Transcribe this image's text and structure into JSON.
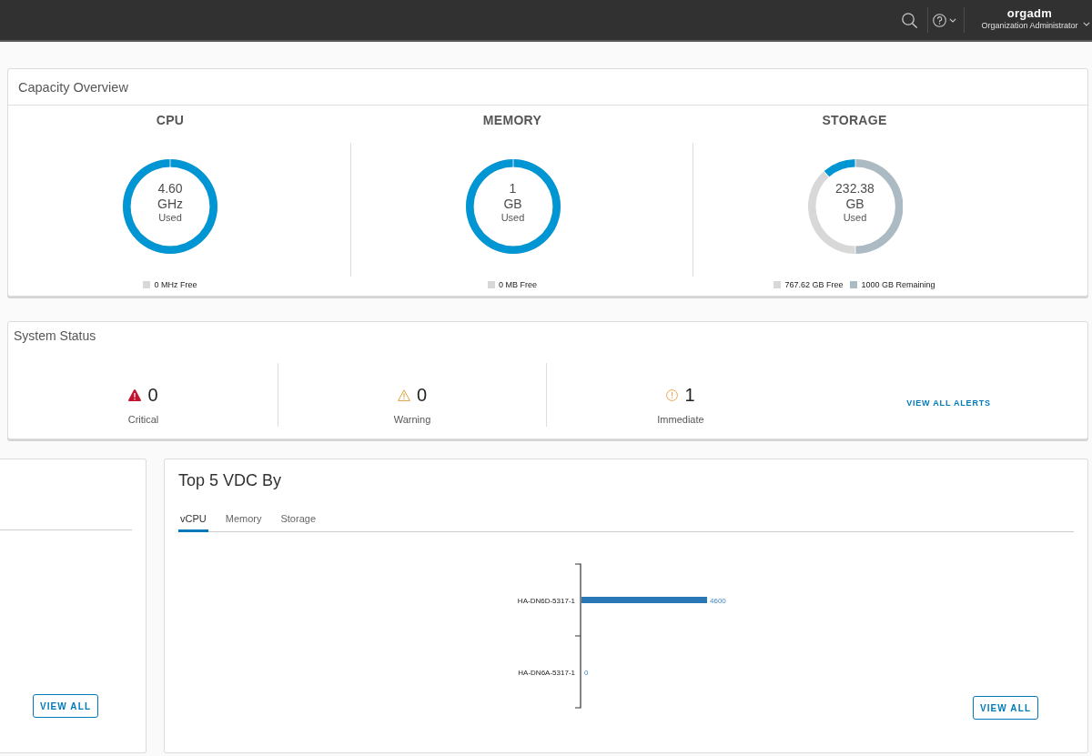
{
  "header": {
    "user_name": "orgadm",
    "user_role": "Organization Administrator"
  },
  "capacity_overview": {
    "title": "Capacity Overview",
    "panels": [
      {
        "title": "CPU",
        "used_value": "4.60",
        "used_unit": "GHz",
        "used_label": "Used",
        "level": 1,
        "legend": [
          {
            "label": "0 MHz Free",
            "color": "#d8d8d8"
          }
        ]
      },
      {
        "title": "MEMORY",
        "used_value": "1",
        "used_unit": "GB",
        "used_label": "Used",
        "level": 1,
        "legend": [
          {
            "label": "0 MB Free",
            "color": "#d8d8d8"
          }
        ]
      },
      {
        "title": "STORAGE",
        "used_value": "232.38",
        "used_unit": "GB",
        "used_label": "Used",
        "legend": [
          {
            "label": "767.62 GB Free",
            "color": "#d8d8d8"
          },
          {
            "label": "1000 GB Remaining",
            "color": "#acbac3"
          }
        ],
        "chart_data": {
          "type": "donut",
          "values": [
            11.62,
            38.38,
            50
          ]
        }
      }
    ]
  },
  "system_status": {
    "title": "System Status",
    "counters": [
      {
        "kind": "critical",
        "count": "0",
        "label": "Critical"
      },
      {
        "kind": "warning",
        "count": "0",
        "label": "Warning"
      },
      {
        "kind": "immediate",
        "count": "1",
        "label": "Immediate"
      }
    ],
    "view_all_link": "VIEW ALL ALERTS"
  },
  "left_panel": {
    "button": "VIEW ALL"
  },
  "top_vdc": {
    "title": "Top 5 VDC By",
    "tabs": [
      {
        "label": "vCPU",
        "selected": true
      },
      {
        "label": "Memory",
        "selected": false
      },
      {
        "label": "Storage",
        "selected": false
      }
    ],
    "chart_data": {
      "type": "bar",
      "orientation": "horizontal",
      "categories": [
        "HA-DN6D-5317-1",
        "HA-DN6A-5317-1"
      ],
      "values": [
        4600,
        0
      ],
      "data_labels": true
    },
    "button": "VIEW ALL"
  }
}
